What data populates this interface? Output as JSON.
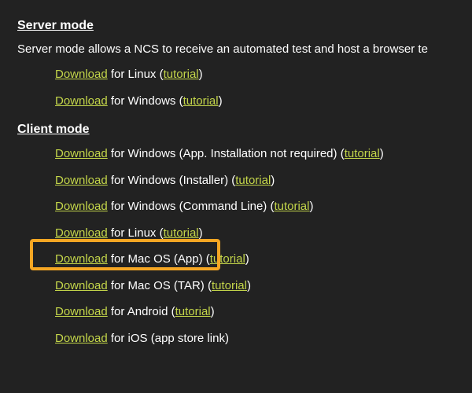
{
  "colors": {
    "link": "#c4d64a",
    "highlight": "#f5a623",
    "bg": "#222222"
  },
  "server": {
    "heading": "Server mode",
    "desc": "Server mode allows a NCS to receive an automated test and host a browser te",
    "items": [
      {
        "download": "Download",
        "for": " for Linux (",
        "tutorial": "tutorial",
        "close": ")"
      },
      {
        "download": "Download",
        "for": " for Windows (",
        "tutorial": "tutorial",
        "close": ")"
      }
    ]
  },
  "client": {
    "heading": "Client mode",
    "items": [
      {
        "download": "Download",
        "for": " for Windows (App. Installation not required) (",
        "tutorial": "tutorial",
        "close": ")"
      },
      {
        "download": "Download",
        "for": " for Windows (Installer) (",
        "tutorial": "tutorial",
        "close": ")"
      },
      {
        "download": "Download",
        "for": " for Windows (Command Line) (",
        "tutorial": "tutorial",
        "close": ")"
      },
      {
        "download": "Download",
        "for": " for Linux (",
        "tutorial": "tutorial",
        "close": ")"
      },
      {
        "download": "Download",
        "for": " for Mac OS (App) (",
        "tutorial": "tutorial",
        "close": ")"
      },
      {
        "download": "Download",
        "for": " for Mac OS (TAR) (",
        "tutorial": "tutorial",
        "close": ")"
      },
      {
        "download": "Download",
        "for": " for Android (",
        "tutorial": "tutorial",
        "close": ")"
      },
      {
        "download": "Download",
        "for": " for iOS (app store link)",
        "tutorial": "",
        "close": ""
      }
    ]
  }
}
